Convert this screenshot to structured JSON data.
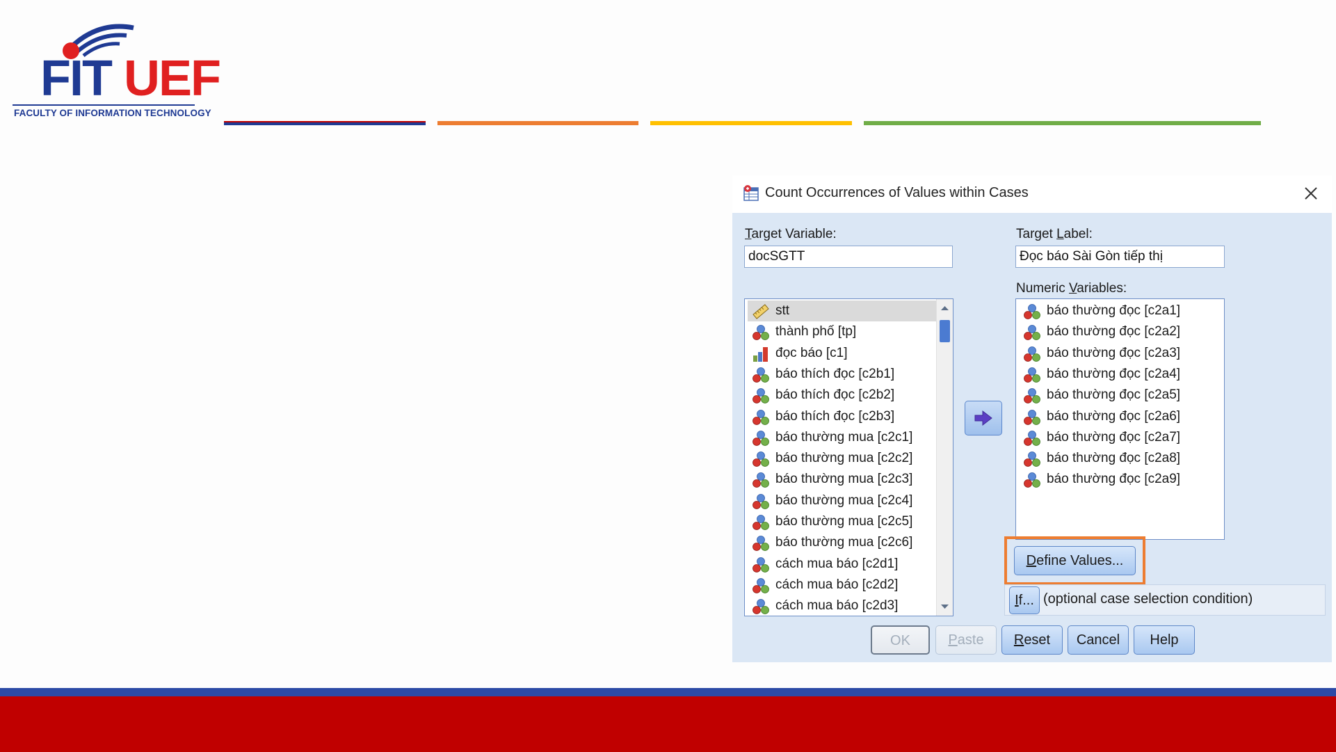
{
  "slide": {
    "logo": {
      "brand_left": "FIT",
      "brand_right": "UEF",
      "subtitle": "FACULTY OF INFORMATION TECHNOLOGY"
    },
    "bar_colors": [
      "#1f3a93",
      "#ed7d31",
      "#ffc000",
      "#70ad47"
    ],
    "footer_colors": {
      "blue": "#2c4aa6",
      "red": "#c00000"
    }
  },
  "dialog": {
    "title": "Count Occurrences of Values within Cases",
    "title_icon": "spss-transform-icon",
    "close_icon": "close-icon",
    "target_variable": {
      "label_pre": "",
      "label_key": "T",
      "label_post": "arget Variable:",
      "value": "docSGTT"
    },
    "target_label": {
      "label_pre": "Target ",
      "label_key": "L",
      "label_post": "abel:",
      "value": "Đọc báo Sài Gòn tiếp thị"
    },
    "numeric_variables_label": {
      "pre": "Numeric ",
      "key": "V",
      "post": "ariables:"
    },
    "source_list": [
      {
        "label": "stt",
        "icon": "scale-ruler-icon",
        "selected": true
      },
      {
        "label": "thành phố [tp]",
        "icon": "nominal-variable-icon"
      },
      {
        "label": "đọc báo [c1]",
        "icon": "ordinal-bar-icon"
      },
      {
        "label": "báo thích đọc [c2b1]",
        "icon": "nominal-variable-icon"
      },
      {
        "label": "báo thích đọc [c2b2]",
        "icon": "nominal-variable-icon"
      },
      {
        "label": "báo thích đọc [c2b3]",
        "icon": "nominal-variable-icon"
      },
      {
        "label": "báo thường mua [c2c1]",
        "icon": "nominal-variable-icon"
      },
      {
        "label": "báo thường mua [c2c2]",
        "icon": "nominal-variable-icon"
      },
      {
        "label": "báo thường mua [c2c3]",
        "icon": "nominal-variable-icon"
      },
      {
        "label": "báo thường mua [c2c4]",
        "icon": "nominal-variable-icon"
      },
      {
        "label": "báo thường mua [c2c5]",
        "icon": "nominal-variable-icon"
      },
      {
        "label": "báo thường mua [c2c6]",
        "icon": "nominal-variable-icon"
      },
      {
        "label": "cách mua báo [c2d1]",
        "icon": "nominal-variable-icon"
      },
      {
        "label": "cách mua báo [c2d2]",
        "icon": "nominal-variable-icon"
      },
      {
        "label": "cách mua báo [c2d3]",
        "icon": "nominal-variable-icon"
      }
    ],
    "numeric_list": [
      {
        "label": "báo thường đọc [c2a1]",
        "icon": "nominal-variable-icon"
      },
      {
        "label": "báo thường đọc [c2a2]",
        "icon": "nominal-variable-icon"
      },
      {
        "label": "báo thường đọc [c2a3]",
        "icon": "nominal-variable-icon"
      },
      {
        "label": "báo thường đọc [c2a4]",
        "icon": "nominal-variable-icon"
      },
      {
        "label": "báo thường đọc [c2a5]",
        "icon": "nominal-variable-icon"
      },
      {
        "label": "báo thường đọc [c2a6]",
        "icon": "nominal-variable-icon"
      },
      {
        "label": "báo thường đọc [c2a7]",
        "icon": "nominal-variable-icon"
      },
      {
        "label": "báo thường đọc [c2a8]",
        "icon": "nominal-variable-icon"
      },
      {
        "label": "báo thường đọc [c2a9]",
        "icon": "nominal-variable-icon"
      }
    ],
    "move_icon": "arrow-right-icon",
    "define_values": {
      "key": "D",
      "rest": "efine Values..."
    },
    "if_button": {
      "key": "I",
      "rest": "f..."
    },
    "if_condition_text": "(optional case selection condition)",
    "buttons": {
      "ok": "OK",
      "paste": {
        "key": "P",
        "rest": "aste"
      },
      "reset": {
        "key": "R",
        "rest": "eset"
      },
      "cancel": "Cancel",
      "help": "Help"
    },
    "highlight_color": "#ed7d31"
  }
}
